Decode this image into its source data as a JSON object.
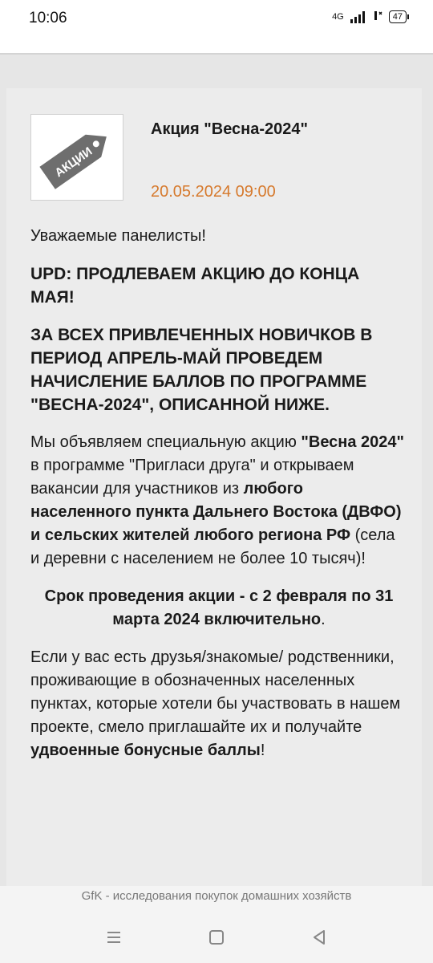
{
  "status_bar": {
    "time": "10:06",
    "network": "4G",
    "battery": "47"
  },
  "post": {
    "thumb_text": "АКЦИИ",
    "title": "Акция \"Весна-2024\"",
    "date": "20.05.2024 09:00",
    "greeting": "Уважаемые панелисты!",
    "upd": "UPD: ПРОДЛЕВАЕМ АКЦИЮ ДО КОНЦА МАЯ!",
    "announcement": "ЗА ВСЕХ ПРИВЛЕЧЕННЫХ НОВИЧКОВ В ПЕРИОД АПРЕЛЬ-МАЙ ПРОВЕДЕМ НАЧИСЛЕНИЕ БАЛЛОВ ПО ПРОГРАММЕ \"ВЕСНА-2024\", ОПИСАННОЙ НИЖЕ.",
    "para1": {
      "a": "Мы объявляем специальную акцию ",
      "b": "\"Весна 2024\"",
      "c": " в программе \"Пригласи друга\" и открываем вакансии для участников из ",
      "d": "любого населенного пункта Дальнего Востока (ДВФО) и сельских жителей любого региона РФ",
      "e": " (села и деревни с населением не более 10 тысяч)!"
    },
    "term": {
      "bold": "Срок проведения акции - с 2 февраля по 31 марта 2024 включительно",
      "tail": "."
    },
    "para3": {
      "a": "Если у вас есть друзья/знакомые/ родственники, проживающие в обозначенных населенных пунктах, которые хотели бы участвовать в нашем проекте, смело приглашайте их и получайте ",
      "b": "удвоенные бонусные баллы",
      "c": "!"
    }
  },
  "footer": {
    "caption": "GfK - исследования покупок домашних хозяйств"
  }
}
